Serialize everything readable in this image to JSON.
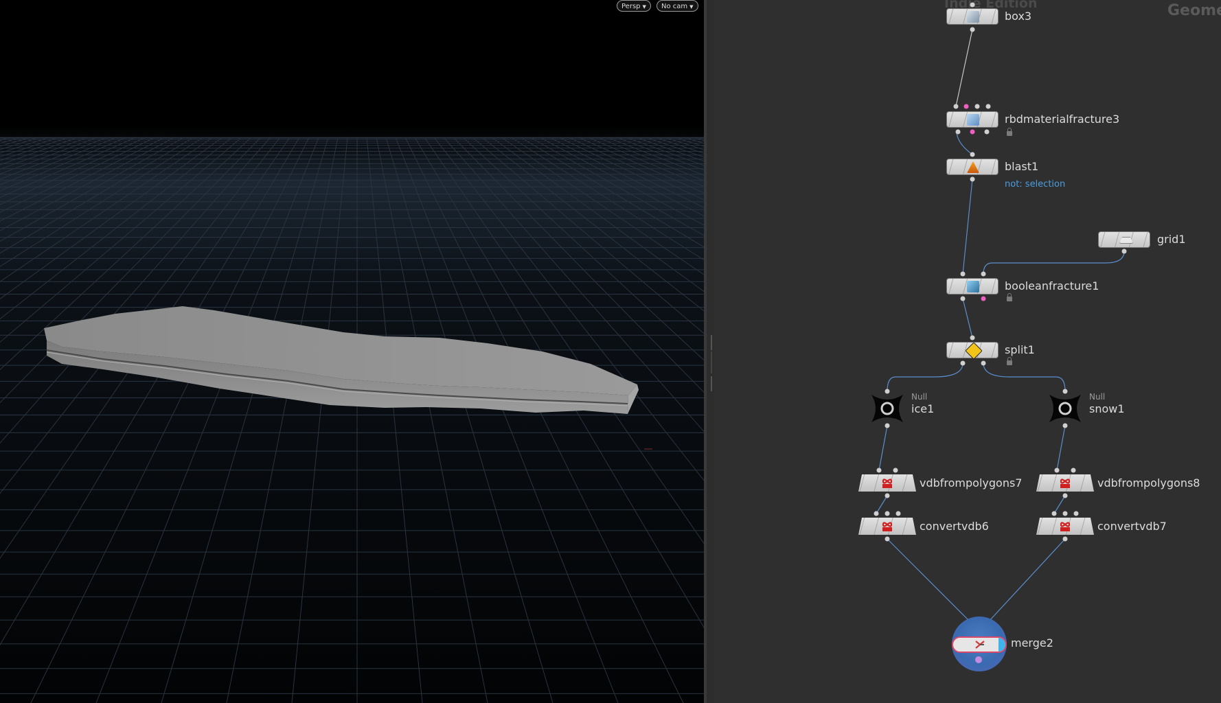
{
  "viewport": {
    "camera_menu": "Persp",
    "cam_menu": "No cam"
  },
  "network": {
    "watermark_left": "Indie Edition",
    "watermark_right": "Geome",
    "nodes": {
      "box3": {
        "label": "box3"
      },
      "rbdmaterialfracture3": {
        "label": "rbdmaterialfracture3"
      },
      "blast1": {
        "label": "blast1",
        "comment": "not: selection"
      },
      "grid1": {
        "label": "grid1"
      },
      "booleanfracture1": {
        "label": "booleanfracture1"
      },
      "split1": {
        "label": "split1"
      },
      "ice1": {
        "label": "ice1",
        "type": "Null"
      },
      "snow1": {
        "label": "snow1",
        "type": "Null"
      },
      "vdbfrompolygons7": {
        "label": "vdbfrompolygons7"
      },
      "vdbfrompolygons8": {
        "label": "vdbfrompolygons8"
      },
      "convertvdb6": {
        "label": "convertvdb6"
      },
      "convertvdb7": {
        "label": "convertvdb7"
      },
      "merge2": {
        "label": "merge2"
      }
    }
  },
  "colors": {
    "wire": "#5b8fcf",
    "wire_gray": "#c8c8c8",
    "comment": "#4d9de0",
    "viewport_grid": "#2a3440",
    "network_bg": "#2f2f2f"
  }
}
